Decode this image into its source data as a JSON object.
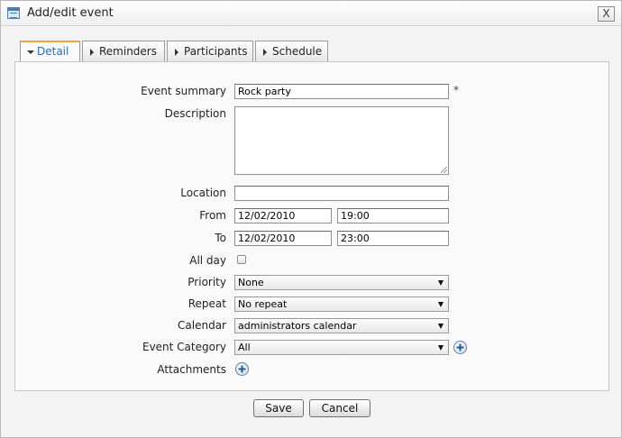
{
  "window": {
    "title": "Add/edit event",
    "title_icon": "calendar-window-icon",
    "close_label": "X"
  },
  "tabs": [
    {
      "label": "Detail",
      "active": true
    },
    {
      "label": "Reminders",
      "active": false
    },
    {
      "label": "Participants",
      "active": false
    },
    {
      "label": "Schedule",
      "active": false
    }
  ],
  "form": {
    "summary": {
      "label": "Event summary",
      "value": "Rock party",
      "required_mark": "*"
    },
    "description": {
      "label": "Description",
      "value": ""
    },
    "location": {
      "label": "Location",
      "value": ""
    },
    "from": {
      "label": "From",
      "date": "12/02/2010",
      "time": "19:00"
    },
    "to": {
      "label": "To",
      "date": "12/02/2010",
      "time": "23:00"
    },
    "all_day": {
      "label": "All day",
      "checked": false
    },
    "priority": {
      "label": "Priority",
      "value": "None"
    },
    "repeat": {
      "label": "Repeat",
      "value": "No repeat"
    },
    "calendar": {
      "label": "Calendar",
      "value": "administrators calendar"
    },
    "category": {
      "label": "Event Category",
      "value": "All"
    },
    "attachments": {
      "label": "Attachments"
    }
  },
  "buttons": {
    "save": "Save",
    "cancel": "Cancel"
  },
  "colors": {
    "active_tab_text": "#2a6bb0",
    "active_tab_accent": "#f3a640",
    "panel_bg": "#fafafa",
    "dialog_bg": "#f3f3f3"
  }
}
